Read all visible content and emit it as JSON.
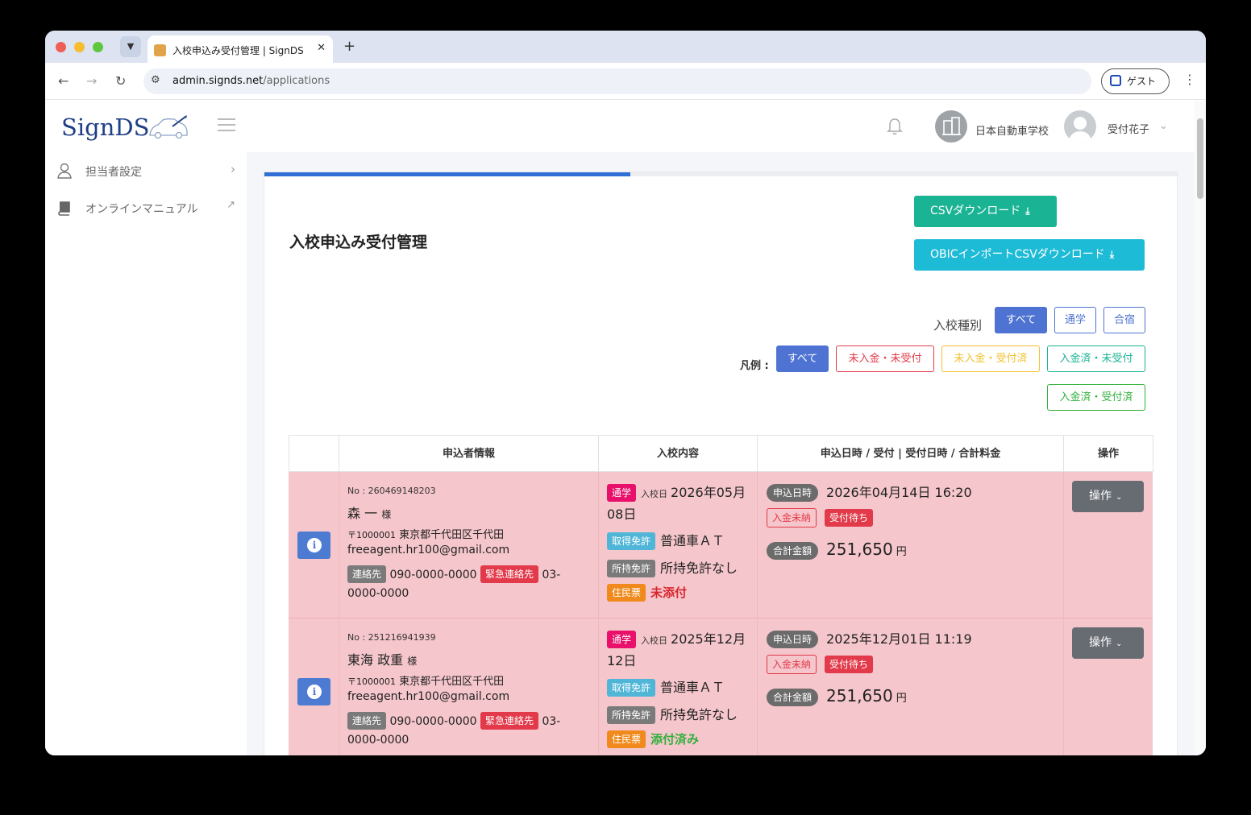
{
  "browser": {
    "tab_title": "入校申込み受付管理 | SignDS（",
    "url_host": "admin.signds.net",
    "url_path": "/applications",
    "profile_label": "ゲスト"
  },
  "header": {
    "logo": "SignDS",
    "school_name": "日本自動車学校",
    "user_name": "受付花子"
  },
  "sidebar": {
    "items": [
      {
        "label": "担当者設定"
      },
      {
        "label": "オンラインマニュアル"
      }
    ]
  },
  "main": {
    "progress": 0.4,
    "title": "入校申込み受付管理",
    "csv_button": "CSVダウンロード",
    "obic_button": "OBICインポートCSVダウンロード",
    "type_filter": {
      "label": "入校種別",
      "options": [
        "すべて",
        "通学",
        "合宿"
      ],
      "selected": "すべて"
    },
    "legend": {
      "label": "凡例 :",
      "items": [
        "すべて",
        "未入金・未受付",
        "未入金・受付済",
        "入金済・未受付",
        "入金済・受付済"
      ],
      "selected": "すべて"
    },
    "colors": {
      "primary": "#4e73d2",
      "unpaid_unaccepted": "#e23a4a",
      "unpaid_accepted": "#f2c12e",
      "paid_unaccepted": "#1ab394",
      "paid_accepted": "#31b03b",
      "row_unpaid_unaccepted": "#f5c6cb"
    },
    "table": {
      "headers": [
        "",
        "申込者情報",
        "入校内容",
        "申込日時 / 受付 | 受付日時 / 合計料金",
        "操作"
      ],
      "tags": {
        "contact": "連絡先",
        "emergency": "緊急連絡先",
        "license_acquire": "取得免許",
        "license_held": "所持免許",
        "resident_card": "住民票",
        "applied_at": "申込日時",
        "total": "合計金額",
        "entry_date": "入校日",
        "honorific": "様",
        "currency": "円",
        "op_button": "操作"
      },
      "rows": [
        {
          "no": "No : 260469148203",
          "name": "森 一",
          "postal": "〒1000001",
          "address": "東京都千代田区千代田",
          "email": "freeagent.hr100@gmail.com",
          "phone": "090-0000-0000",
          "emergency_phone": "03-0000-0000",
          "course_type": "通学",
          "entry_date": "2026年05月08日",
          "license": "普通車ＡＴ",
          "held_license": "所持免許なし",
          "resident_status": "未添付",
          "applied_at": "2026年04月14日 16:20",
          "payment_status": "入金未納",
          "accept_status": "受付待ち",
          "total": "251,650"
        },
        {
          "no": "No : 251216941939",
          "name": "東海 政重",
          "postal": "〒1000001",
          "address": "東京都千代田区千代田",
          "email": "freeagent.hr100@gmail.com",
          "phone": "090-0000-0000",
          "emergency_phone": "03-0000-0000",
          "course_type": "通学",
          "entry_date": "2025年12月12日",
          "license": "普通車ＡＴ",
          "held_license": "所持免許なし",
          "resident_status": "添付済み",
          "applied_at": "2025年12月01日 11:19",
          "payment_status": "入金未納",
          "accept_status": "受付待ち",
          "total": "251,650"
        }
      ]
    }
  }
}
